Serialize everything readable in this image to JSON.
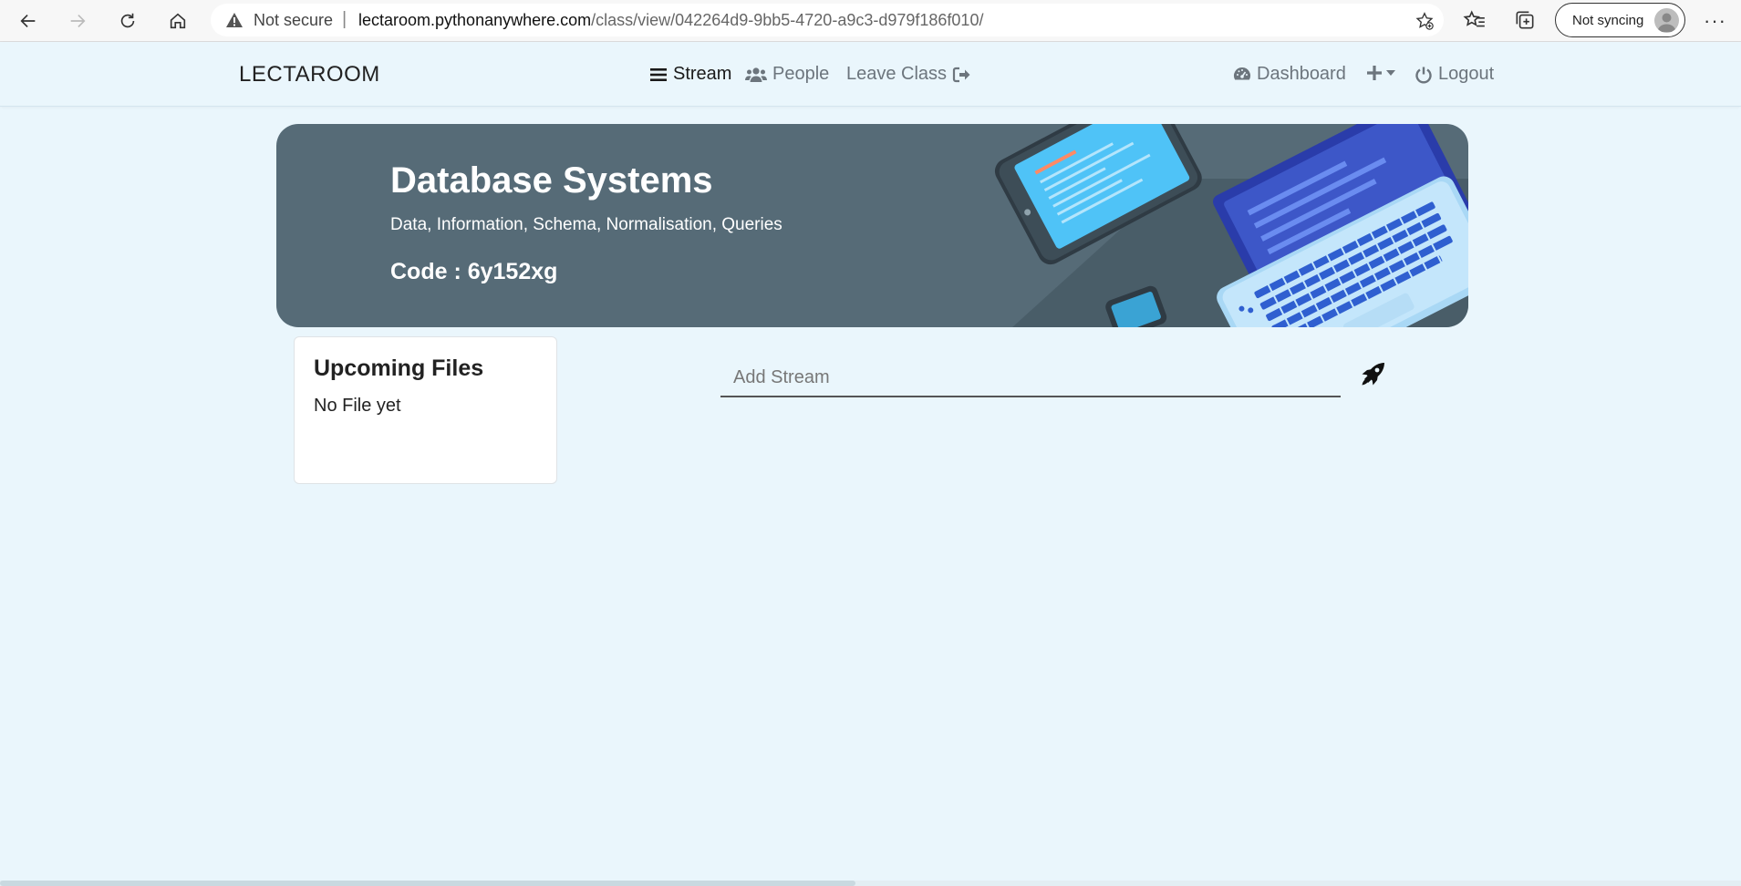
{
  "browser": {
    "security_label": "Not secure",
    "url_host": "lectaroom.pythonanywhere.com",
    "url_path": "/class/view/042264d9-9bb5-4720-a9c3-d979f186f010/",
    "sync_label": "Not syncing",
    "more_label": "···"
  },
  "navbar": {
    "brand": "LECTAROOM",
    "links": {
      "stream": "Stream",
      "people": "People",
      "leave": "Leave Class",
      "dashboard": "Dashboard",
      "logout": "Logout"
    }
  },
  "banner": {
    "title": "Database Systems",
    "subtitle": "Data, Information, Schema, Normalisation, Queries",
    "code": "Code : 6y152xg"
  },
  "upcoming": {
    "title": "Upcoming Files",
    "empty_text": "No File yet"
  },
  "stream": {
    "placeholder": "Add Stream"
  },
  "colors": {
    "page_bg": "#eaf6fc",
    "banner_bg": "#566b77",
    "laptop_blue": "#3d57c8",
    "screen_cyan": "#4fc3f7"
  }
}
